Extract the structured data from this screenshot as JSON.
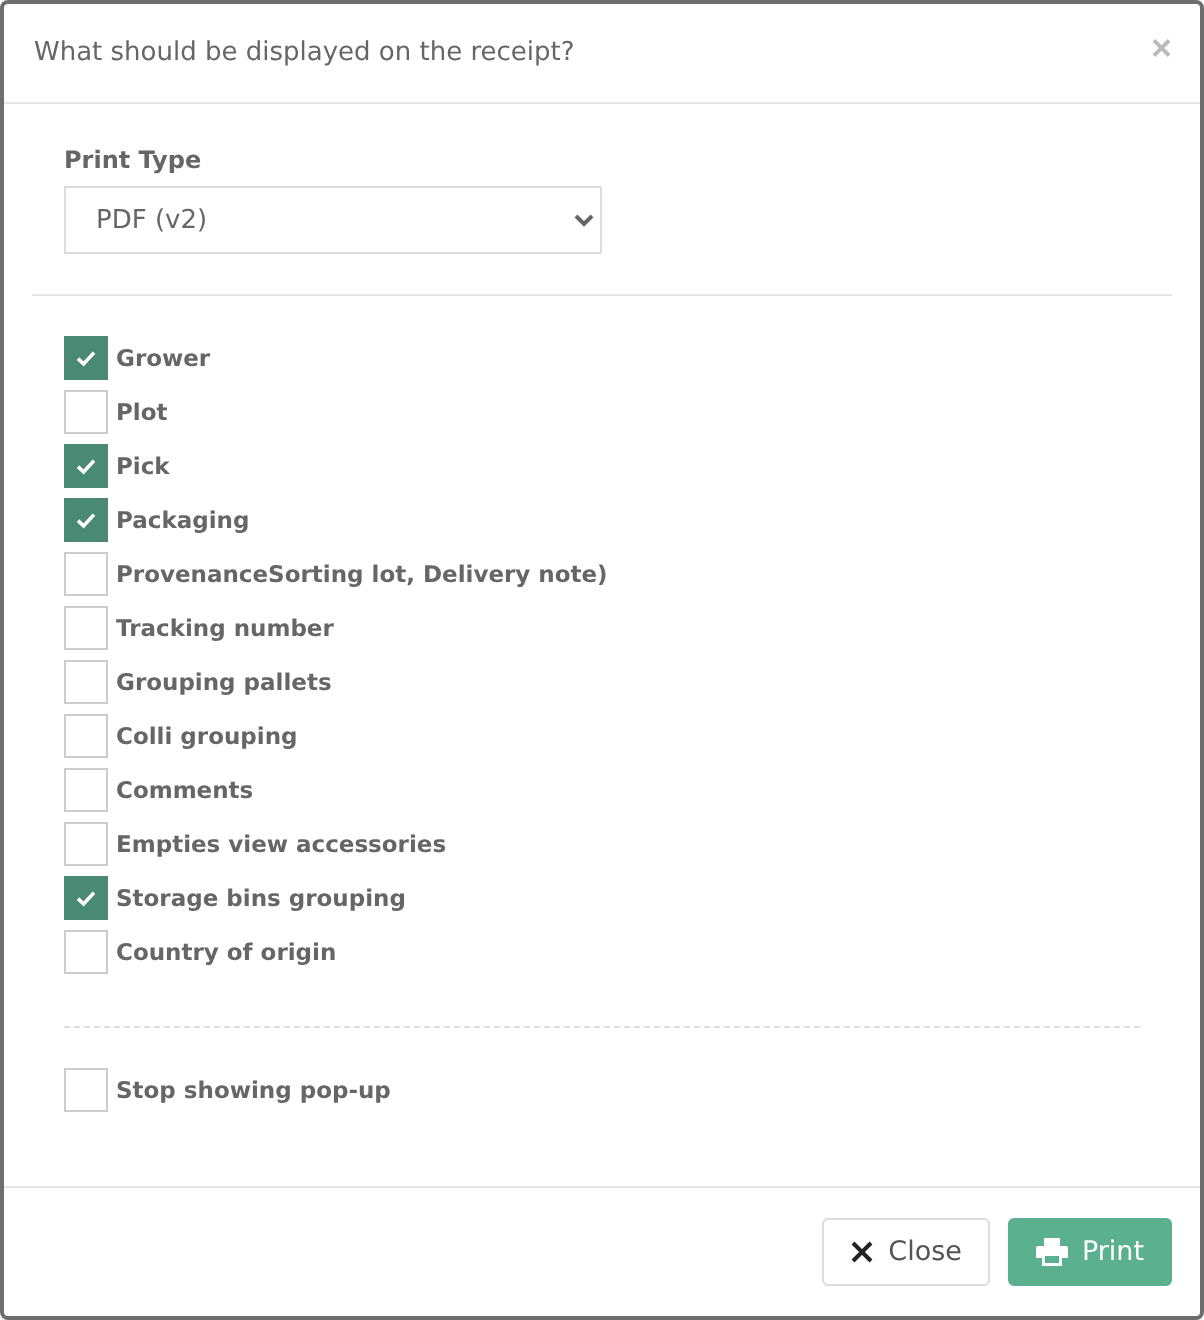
{
  "dialog": {
    "title": "What should be displayed on the receipt?",
    "close_glyph": "×"
  },
  "print_type": {
    "label": "Print Type",
    "value": "PDF (v2)"
  },
  "options": [
    {
      "label": "Grower",
      "checked": true
    },
    {
      "label": "Plot",
      "checked": false
    },
    {
      "label": "Pick",
      "checked": true
    },
    {
      "label": "Packaging",
      "checked": true
    },
    {
      "label": "ProvenanceSorting lot, Delivery note)",
      "checked": false
    },
    {
      "label": "Tracking number",
      "checked": false
    },
    {
      "label": "Grouping pallets",
      "checked": false
    },
    {
      "label": "Colli grouping",
      "checked": false
    },
    {
      "label": "Comments",
      "checked": false
    },
    {
      "label": "Empties view accessories",
      "checked": false
    },
    {
      "label": "Storage bins grouping",
      "checked": true
    },
    {
      "label": "Country of origin",
      "checked": false
    }
  ],
  "stop_popup": {
    "label": "Stop showing pop-up",
    "checked": false
  },
  "buttons": [
    {
      "kind": "close",
      "label": "Close"
    },
    {
      "kind": "print",
      "label": "Print"
    }
  ]
}
